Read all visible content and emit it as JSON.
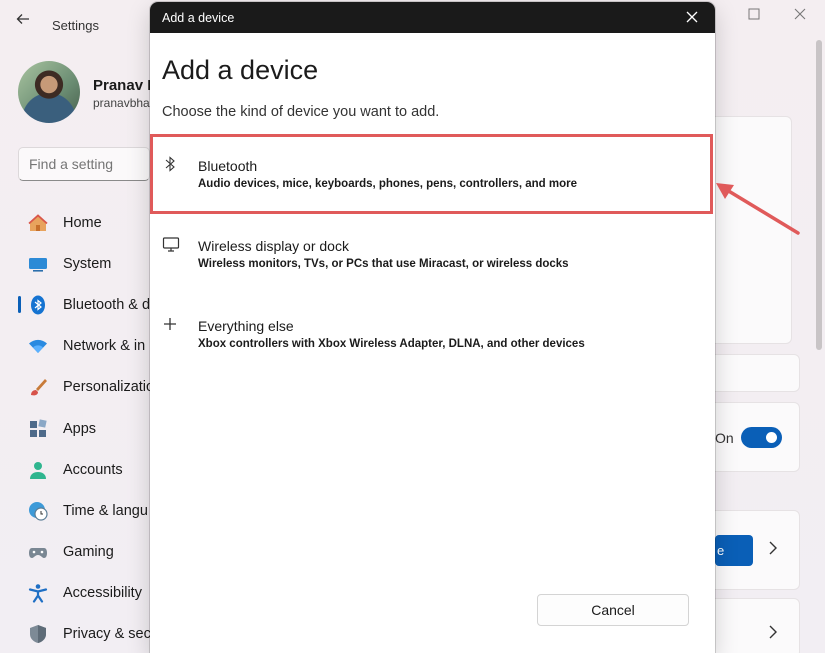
{
  "settings": {
    "title": "Settings",
    "user_name": "Pranav B",
    "user_email": "pranavbha",
    "search_placeholder": "Find a setting",
    "nav": [
      {
        "label": "Home",
        "icon": "home-icon"
      },
      {
        "label": "System",
        "icon": "system-icon"
      },
      {
        "label": "Bluetooth & d",
        "icon": "bluetooth-icon",
        "active": true
      },
      {
        "label": "Network & in",
        "icon": "wifi-icon"
      },
      {
        "label": "Personalizatio",
        "icon": "brush-icon"
      },
      {
        "label": "Apps",
        "icon": "apps-icon"
      },
      {
        "label": "Accounts",
        "icon": "account-icon"
      },
      {
        "label": "Time & langu",
        "icon": "clock-globe-icon"
      },
      {
        "label": "Gaming",
        "icon": "gamepad-icon"
      },
      {
        "label": "Accessibility",
        "icon": "accessibility-icon"
      },
      {
        "label": "Privacy & secu",
        "icon": "shield-icon"
      }
    ],
    "toggle_label": "On",
    "toggle_on": true,
    "blue_button_label": "e"
  },
  "dialog": {
    "titlebar": "Add a device",
    "heading": "Add a device",
    "subtitle": "Choose the kind of device you want to add.",
    "options": [
      {
        "title": "Bluetooth",
        "description": "Audio devices, mice, keyboards, phones, pens, controllers, and more",
        "icon": "bluetooth-icon",
        "highlighted": true
      },
      {
        "title": "Wireless display or dock",
        "description": "Wireless monitors, TVs, or PCs that use Miracast, or wireless docks",
        "icon": "monitor-icon"
      },
      {
        "title": "Everything else",
        "description": "Xbox controllers with Xbox Wireless Adapter, DLNA, and other devices",
        "icon": "plus-icon"
      }
    ],
    "cancel_label": "Cancel"
  },
  "colors": {
    "accent": "#0a5fb7",
    "highlight": "#e05a5a",
    "dialog_titlebar": "#1a1a1a"
  }
}
